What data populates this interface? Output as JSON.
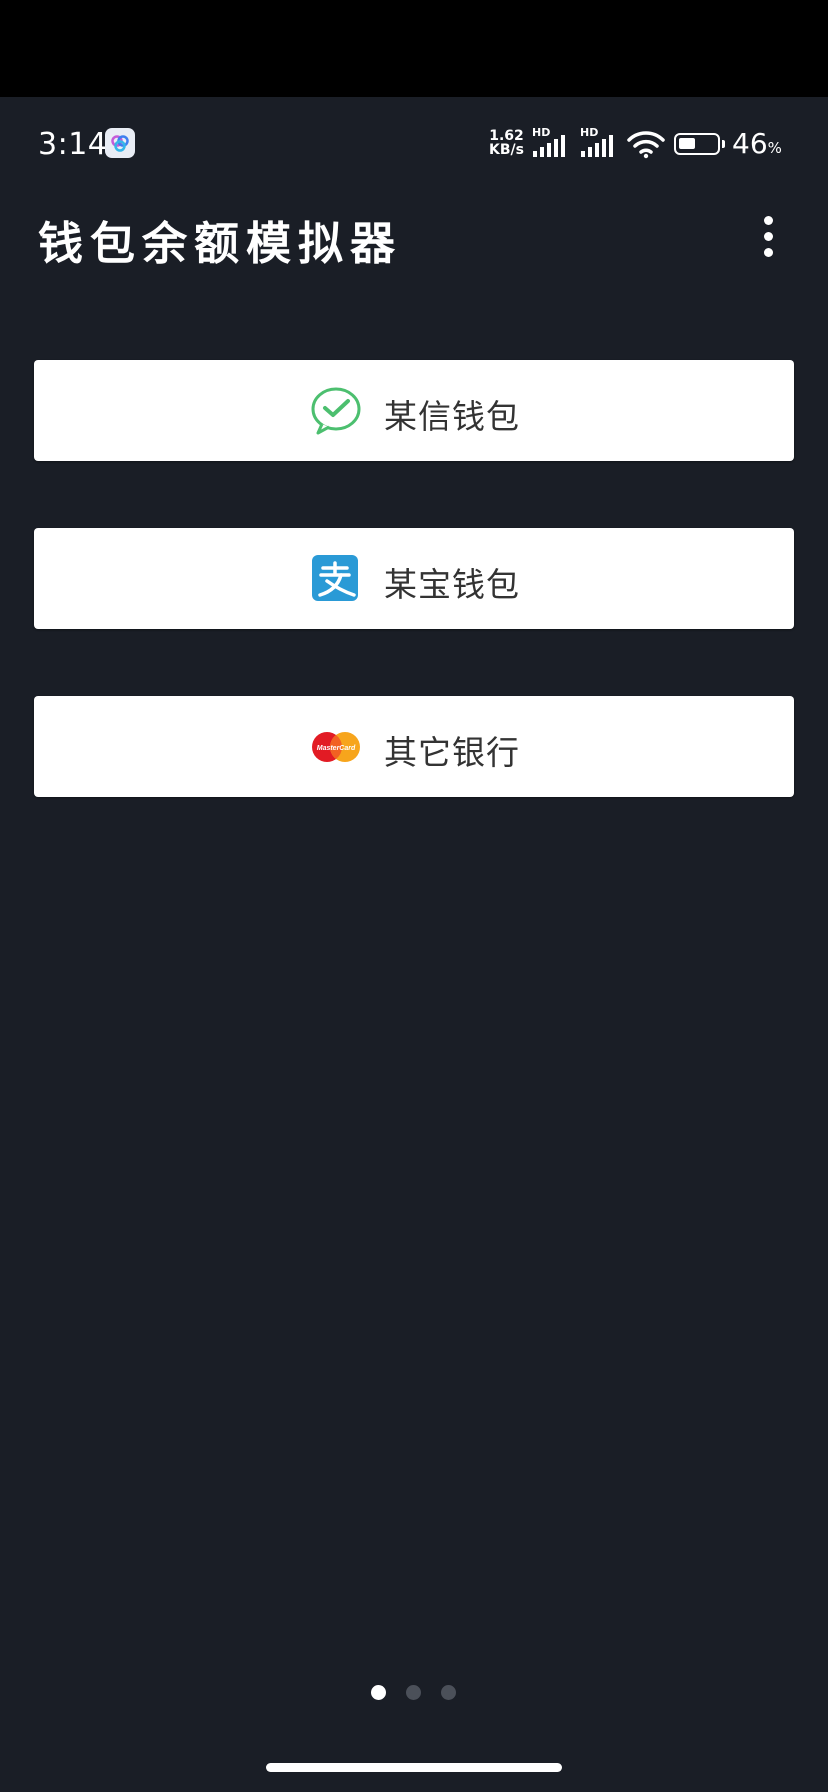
{
  "status_bar": {
    "time": "3:14",
    "net_speed_value": "1.62",
    "net_speed_unit": "KB/s",
    "sim1_label": "HD",
    "sim2_label": "HD",
    "battery_level_fraction": 0.46,
    "battery_percent": "46",
    "battery_percent_sign": "%"
  },
  "app_bar": {
    "title": "钱包余额模拟器",
    "menu_icon": "more-vert-icon"
  },
  "options": [
    {
      "label": "某信钱包",
      "icon": "wechat-icon",
      "icon_color": "#4cbf6f"
    },
    {
      "label": "某宝钱包",
      "icon": "alipay-icon",
      "icon_color": "#2a9ad6"
    },
    {
      "label": "其它银行",
      "icon": "mastercard-icon",
      "icon_color": "#e21b24"
    }
  ],
  "pager": {
    "count": 3,
    "active_index": 0
  },
  "colors": {
    "background": "#1a1e26",
    "card": "#ffffff",
    "text_dark": "#333333",
    "dot_inactive": "#4b5059"
  }
}
